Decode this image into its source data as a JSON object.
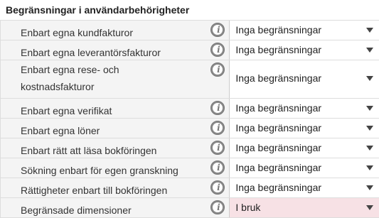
{
  "section": {
    "title": "Begränsningar i användarbehörigheter"
  },
  "rows": [
    {
      "label": "Enbart egna kundfakturor",
      "value": "Inga begränsningar"
    },
    {
      "label": "Enbart egna leverantörsfakturor",
      "value": "Inga begränsningar"
    },
    {
      "label": "Enbart egna rese- och kostnadsfakturor",
      "value": "Inga begränsningar"
    },
    {
      "label": "Enbart egna verifikat",
      "value": "Inga begränsningar"
    },
    {
      "label": "Enbart egna löner",
      "value": "Inga begränsningar"
    },
    {
      "label": "Enbart rätt att läsa bokföringen",
      "value": "Inga begränsningar"
    },
    {
      "label": "Sökning enbart för egen granskning",
      "value": "Inga begränsningar"
    },
    {
      "label": "Rättigheter enbart till bokföringen",
      "value": "Inga begränsningar"
    },
    {
      "label": "Begränsade dimensioner",
      "value": "I bruk"
    }
  ],
  "info_icon_glyph": "i",
  "colors": {
    "in_use_background": "#f7e1e5",
    "label_background": "#f4f4f4"
  }
}
